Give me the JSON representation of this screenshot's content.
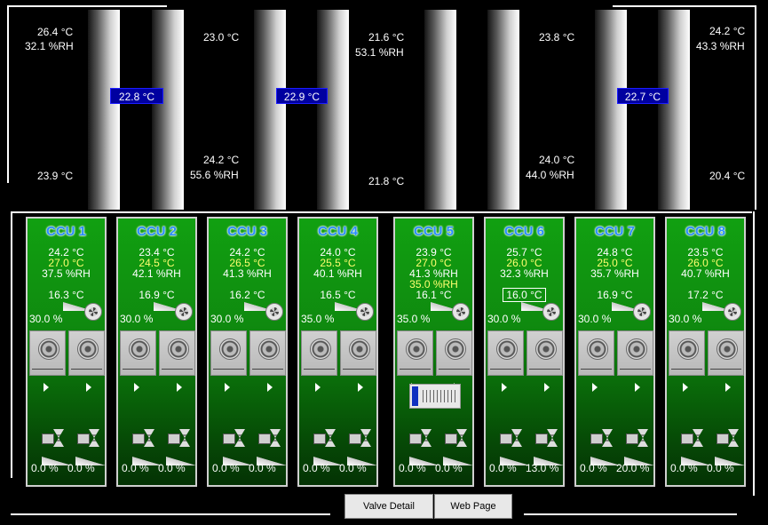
{
  "sensors": {
    "t1": "26.4 °C",
    "t1_rh": "32.1 %RH",
    "b1": "23.9 °C",
    "t2": "23.0 °C",
    "b2": "24.2 °C",
    "b2_rh": "55.6 %RH",
    "t3": "21.6 °C",
    "t3_rh": "53.1 %RH",
    "b3": "21.8 °C",
    "t4": "23.8 °C",
    "b4": "24.0 °C",
    "b4_rh": "44.0 %RH",
    "t5": "24.2 °C",
    "t5_rh": "43.3 %RH",
    "b5": "20.4 °C"
  },
  "aisle_avg": [
    "22.8 °C",
    "22.9 °C",
    "22.7 °C"
  ],
  "ccus": [
    {
      "name": "CCU 1",
      "return_t": "24.2 °C",
      "l2": "27.0 °C",
      "rh": "37.5 %RH",
      "supply": "16.3 °C",
      "fan": "30.0 %",
      "v1": "0.0 %",
      "v2": "0.0 %"
    },
    {
      "name": "CCU 2",
      "return_t": "23.4 °C",
      "l2": "24.5 °C",
      "rh": "42.1 %RH",
      "supply": "16.9 °C",
      "fan": "30.0 %",
      "v1": "0.0 %",
      "v2": "0.0 %"
    },
    {
      "name": "CCU 3",
      "return_t": "24.2 °C",
      "l2": "26.5 °C",
      "rh": "41.3 %RH",
      "supply": "16.2 °C",
      "fan": "30.0 %",
      "v1": "0.0 %",
      "v2": "0.0 %"
    },
    {
      "name": "CCU 4",
      "return_t": "24.0 °C",
      "l2": "25.5 °C",
      "rh": "40.1 %RH",
      "supply": "16.5 °C",
      "fan": "35.0 %",
      "v1": "0.0 %",
      "v2": "0.0 %"
    },
    {
      "name": "CCU 5",
      "return_t": "23.9 °C",
      "l2": "27.0 °C",
      "rh": "41.3 %RH",
      "extra": "35.0 %RH",
      "supply": "16.1 °C",
      "fan": "35.0 %",
      "v1": "0.0 %",
      "v2": "0.0 %"
    },
    {
      "name": "CCU 6",
      "return_t": "25.7 °C",
      "l2": "26.0 °C",
      "rh": "32.3 %RH",
      "supply": "16.0 °C",
      "fan": "30.0 %",
      "v1": "0.0 %",
      "v2": "13.0 %"
    },
    {
      "name": "CCU 7",
      "return_t": "24.8 °C",
      "l2": "25.0 °C",
      "rh": "35.7 %RH",
      "supply": "16.9 °C",
      "fan": "30.0 %",
      "v1": "0.0 %",
      "v2": "20.0 %"
    },
    {
      "name": "CCU 8",
      "return_t": "23.5 °C",
      "l2": "26.0 °C",
      "rh": "40.7 %RH",
      "supply": "17.2 °C",
      "fan": "30.0 %",
      "v1": "0.0 %",
      "v2": "0.0 %"
    }
  ],
  "buttons": {
    "valve_detail": "Valve Detail",
    "web_page": "Web Page"
  },
  "colors": {
    "ccu_green": "#11a011",
    "avg_blue": "#0000a0",
    "title_blue": "#2a8cff",
    "yellow_text": "#ffff70"
  }
}
